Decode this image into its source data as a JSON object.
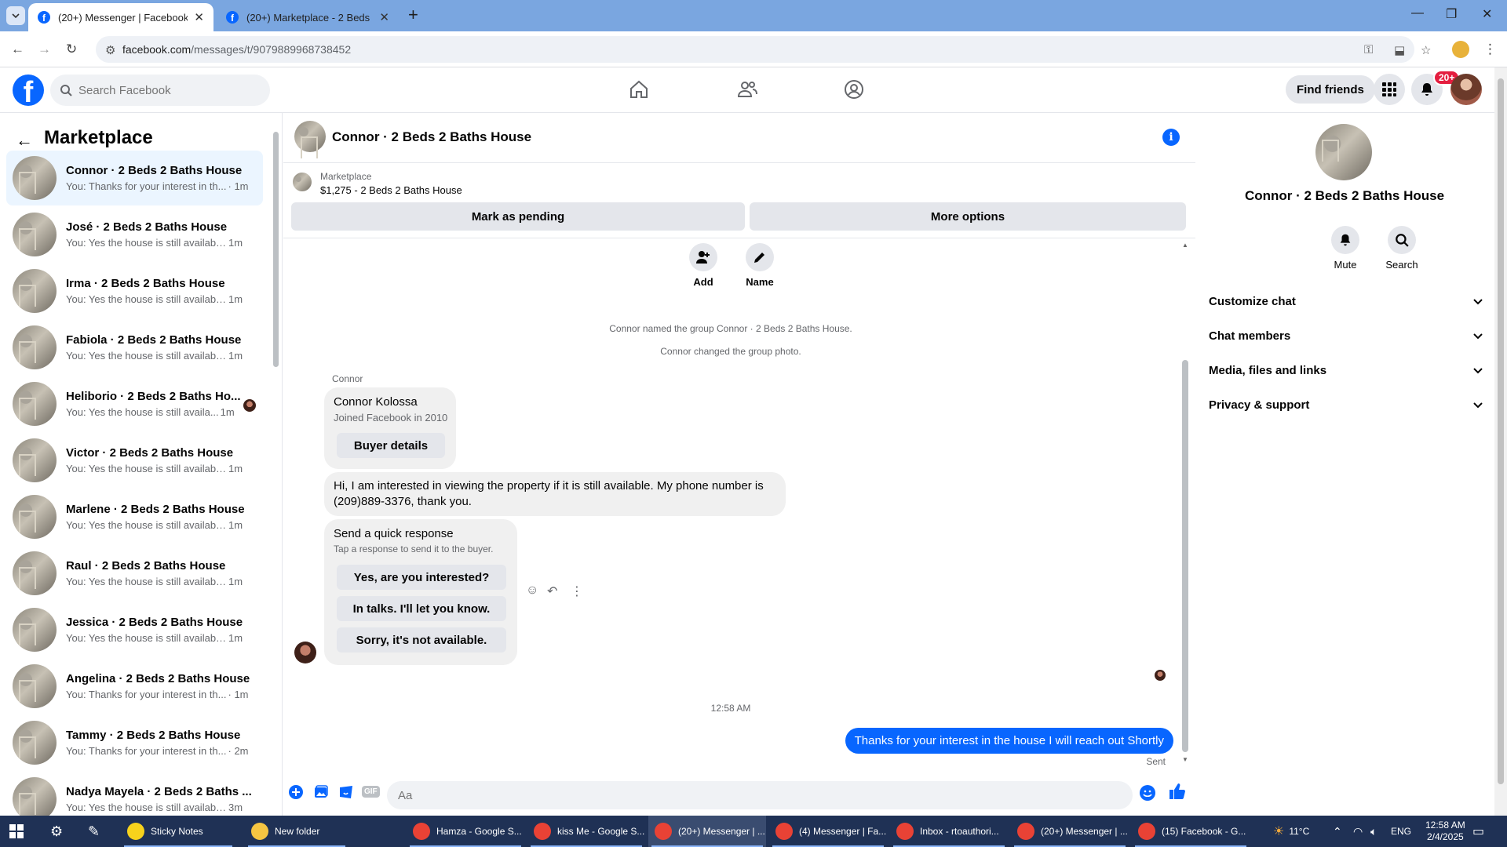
{
  "browser": {
    "tabs": [
      {
        "title": "(20+) Messenger | Facebook",
        "active": true
      },
      {
        "title": "(20+) Marketplace - 2 Beds 2 B",
        "active": false
      }
    ],
    "url_host": "facebook.com",
    "url_path": "/messages/t/9079889968738452"
  },
  "fb_header": {
    "search_placeholder": "Search Facebook",
    "find_friends": "Find friends",
    "notif_badge": "20+"
  },
  "left_panel": {
    "title": "Marketplace",
    "conversations": [
      {
        "name": "Connor · 2 Beds 2 Baths House",
        "preview": "You: Thanks for your interest in th...",
        "time": "· 1m",
        "active": true
      },
      {
        "name": "José · 2 Beds 2 Baths House",
        "preview": "You: Yes the house is still available ...",
        "time": "1m"
      },
      {
        "name": "Irma · 2 Beds 2 Baths House",
        "preview": "You: Yes the house is still available ...",
        "time": "1m"
      },
      {
        "name": "Fabiola · 2 Beds 2 Baths House",
        "preview": "You: Yes the house is still available ...",
        "time": "1m"
      },
      {
        "name": "Heliborio · 2 Beds 2 Baths Ho...",
        "preview": "You: Yes the house is still availa...",
        "time": "1m"
      },
      {
        "name": "Victor · 2 Beds 2 Baths House",
        "preview": "You: Yes the house is still available ...",
        "time": "1m"
      },
      {
        "name": "Marlene · 2 Beds 2 Baths House",
        "preview": "You: Yes the house is still available ...",
        "time": "1m"
      },
      {
        "name": "Raul · 2 Beds 2 Baths House",
        "preview": "You: Yes the house is still available ...",
        "time": "1m"
      },
      {
        "name": "Jessica · 2 Beds 2 Baths House",
        "preview": "You: Yes the house is still available ...",
        "time": "1m"
      },
      {
        "name": "Angelina · 2 Beds 2 Baths House",
        "preview": "You: Thanks for your interest in th...",
        "time": "· 1m"
      },
      {
        "name": "Tammy · 2 Beds 2 Baths House",
        "preview": "You: Thanks for your interest in th...",
        "time": "· 2m"
      },
      {
        "name": "Nadya Mayela · 2 Beds 2 Baths ...",
        "preview": "You: Yes the house is still available ...",
        "time": "3m"
      }
    ]
  },
  "chat": {
    "title": "Connor · 2 Beds 2 Baths House",
    "marketplace_label": "Marketplace",
    "listing": "$1,275 - 2 Beds 2 Baths House",
    "mark_pending": "Mark as pending",
    "more_options": "More options",
    "actions": {
      "add": "Add",
      "name": "Name"
    },
    "system_messages": [
      "Connor named the group Connor · 2 Beds 2 Baths House.",
      "Connor changed the group photo."
    ],
    "sender_label": "Connor",
    "buyer_card": {
      "name": "Connor Kolossa",
      "joined": "Joined Facebook in 2010",
      "button": "Buyer details"
    },
    "incoming_message": "Hi, I am interested in viewing the property if it is still available. My phone number is (209)889-3376, thank you.",
    "quick_response": {
      "title": "Send a quick response",
      "subtitle": "Tap a response to send it to the buyer.",
      "options": [
        "Yes, are you interested?",
        "In talks. I'll let you know.",
        "Sorry, it's not available."
      ]
    },
    "timestamp": "12:58 AM",
    "sent_message": "Thanks for your interest in the house I will reach out Shortly",
    "sent_status": "Sent",
    "composer_placeholder": "Aa",
    "gif_label": "GIF"
  },
  "right_panel": {
    "name": "Connor · 2 Beds 2 Baths House",
    "mute": "Mute",
    "search": "Search",
    "sections": [
      "Customize chat",
      "Chat members",
      "Media, files and links",
      "Privacy & support"
    ]
  },
  "taskbar": {
    "items": [
      {
        "label": "Sticky Notes",
        "color": "#f7d21c"
      },
      {
        "label": "New folder",
        "color": "#f5c542"
      },
      {
        "label": "Hamza - Google S...",
        "color": "#e94235"
      },
      {
        "label": "kiss Me - Google S...",
        "color": "#e94235"
      },
      {
        "label": "(20+) Messenger | ...",
        "color": "#e94235"
      },
      {
        "label": "(4) Messenger | Fa...",
        "color": "#e94235"
      },
      {
        "label": "Inbox - rtoauthori...",
        "color": "#e94235"
      },
      {
        "label": "(20+) Messenger | ...",
        "color": "#e94235"
      },
      {
        "label": "(15) Facebook - G...",
        "color": "#e94235"
      }
    ],
    "weather": "11°C",
    "lang": "ENG",
    "time": "12:58 AM",
    "date": "2/4/2025"
  },
  "colors": {
    "accent": "#0866ff",
    "sent_bubble": "#0866ff",
    "tabbar": "#7aa6e0",
    "taskbar": "#1f3155"
  }
}
